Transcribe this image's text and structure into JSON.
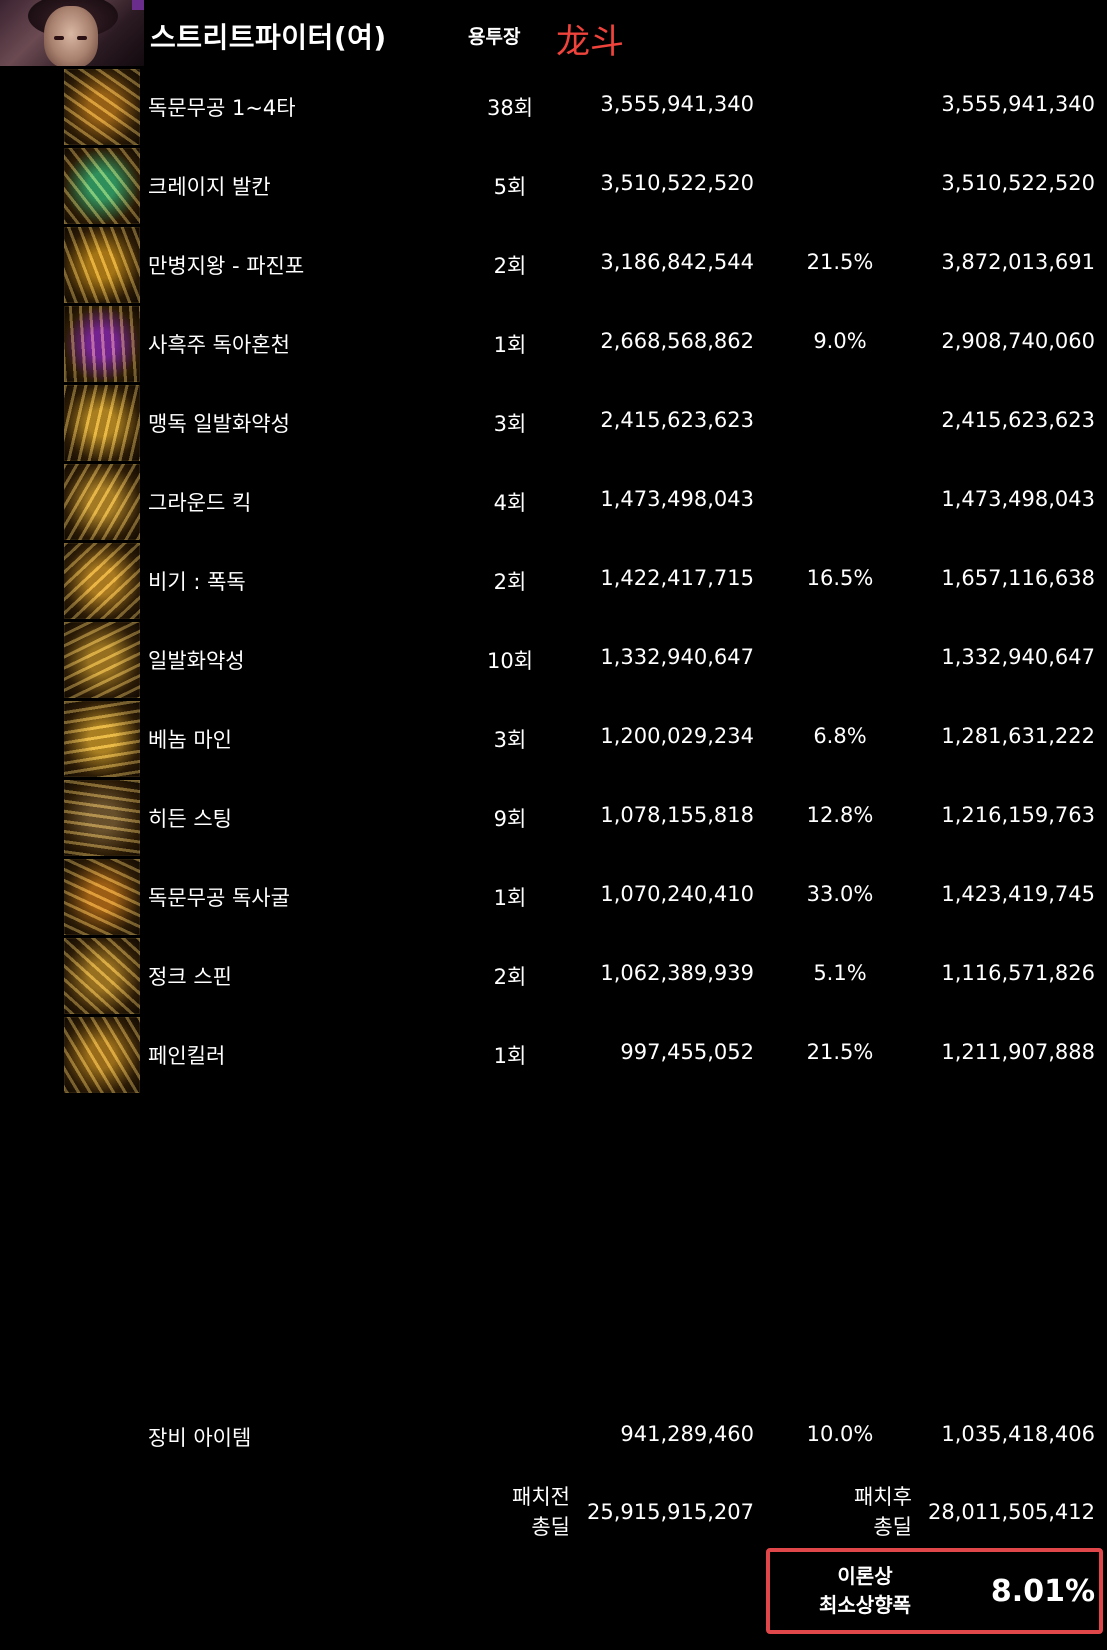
{
  "header": {
    "title": "스트리트파이터(여)",
    "class_name": "용투장",
    "annotation": "龙斗"
  },
  "skills": [
    {
      "name": "독문무공 1~4타",
      "count": "38회",
      "base": "3,555,941,340",
      "pct": "",
      "total": "3,555,941,340",
      "icon": "fire-fang-icon",
      "color": "#c7801c"
    },
    {
      "name": "크레이지 발칸",
      "count": "5회",
      "base": "3,510,522,520",
      "pct": "",
      "total": "3,510,522,520",
      "icon": "green-gadget-icon",
      "color": "#3fbf7a"
    },
    {
      "name": "만병지왕 - 파진포",
      "count": "2회",
      "base": "3,186,842,544",
      "pct": "21.5%",
      "total": "3,872,013,691",
      "icon": "gold-spikes-icon",
      "color": "#d99a1c"
    },
    {
      "name": "사흑주 독아혼천",
      "count": "1회",
      "base": "2,668,568,862",
      "pct": "9.0%",
      "total": "2,908,740,060",
      "icon": "purple-orb-icon",
      "color": "#9a2fc0"
    },
    {
      "name": "맹독 일발화약성",
      "count": "3회",
      "base": "2,415,623,623",
      "pct": "",
      "total": "2,415,623,623",
      "icon": "gold-swirl-icon",
      "color": "#e0a82a"
    },
    {
      "name": "그라운드 킥",
      "count": "4회",
      "base": "1,473,498,043",
      "pct": "",
      "total": "1,473,498,043",
      "icon": "gold-kick-icon",
      "color": "#d9a230"
    },
    {
      "name": "비기 : 폭독",
      "count": "2회",
      "base": "1,422,417,715",
      "pct": "16.5%",
      "total": "1,657,116,638",
      "icon": "gold-skull-star-icon",
      "color": "#e0a12a"
    },
    {
      "name": "일발화약성",
      "count": "10회",
      "base": "1,332,940,647",
      "pct": "",
      "total": "1,332,940,647",
      "icon": "bomb-icon",
      "color": "#c8962a"
    },
    {
      "name": "베놈 마인",
      "count": "3회",
      "base": "1,200,029,234",
      "pct": "6.8%",
      "total": "1,281,631,222",
      "icon": "gold-mine-icon",
      "color": "#e2aa2e"
    },
    {
      "name": "히든 스팅",
      "count": "9회",
      "base": "1,078,155,818",
      "pct": "12.8%",
      "total": "1,216,159,763",
      "icon": "needle-icon",
      "color": "#8a6a3a"
    },
    {
      "name": "독문무공 독사굴",
      "count": "1회",
      "base": "1,070,240,410",
      "pct": "33.0%",
      "total": "1,423,419,745",
      "icon": "flame-snake-icon",
      "color": "#cf7d1a"
    },
    {
      "name": "정크 스핀",
      "count": "2회",
      "base": "1,062,389,939",
      "pct": "5.1%",
      "total": "1,116,571,826",
      "icon": "gold-spin-icon",
      "color": "#c9942a"
    },
    {
      "name": "페인킬러",
      "count": "1회",
      "base": "997,455,052",
      "pct": "21.5%",
      "total": "1,211,907,888",
      "icon": "gold-burst-icon",
      "color": "#c98f22"
    }
  ],
  "equipment": {
    "name": "장비 아이템",
    "base": "941,289,460",
    "pct": "10.0%",
    "total": "1,035,418,406"
  },
  "totals": {
    "before_label_1": "패치전",
    "before_label_2": "총딜",
    "before_value": "25,915,915,207",
    "after_label_1": "패치후",
    "after_label_2": "총딜",
    "after_value": "28,011,505,412"
  },
  "result": {
    "label_1": "이론상",
    "label_2": "최소상향폭",
    "value": "8.01%"
  }
}
